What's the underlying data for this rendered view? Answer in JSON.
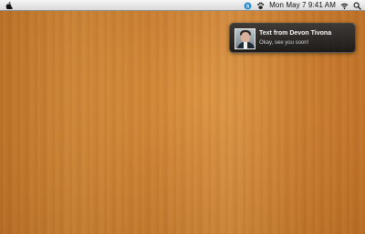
{
  "menu_bar": {
    "apple_icon": "apple-icon",
    "status_icons": [
      "skype-icon",
      "paw-icon",
      "wifi-icon",
      "search-icon"
    ],
    "clock": "Mon May 7  9:41 AM"
  },
  "notification": {
    "title": "Text from Devon Tivona",
    "message": "Okay, see you soon!",
    "avatar": "contact-photo"
  },
  "colors": {
    "menu_bar": "#e8e8e8",
    "notification_bg": "#232323",
    "wood": "#d08434"
  }
}
